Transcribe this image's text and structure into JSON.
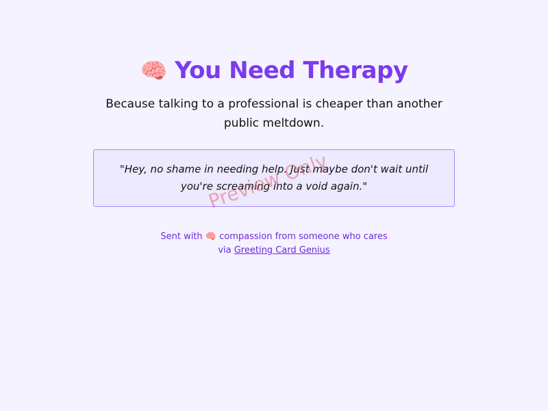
{
  "header": {
    "icon": "brain-icon",
    "emoji": "🧠",
    "title": "You Need Therapy"
  },
  "subtitle": "Because talking to a professional is cheaper than another public meltdown.",
  "quote": "\"Hey, no shame in needing help. Just maybe don't wait until you're screaming into a void again.\"",
  "footer": {
    "sent_prefix": "Sent with",
    "emoji": "🧠",
    "sent_suffix": "compassion from someone who cares",
    "via": "via",
    "link": "Greeting Card Genius"
  },
  "watermark": "Preview Only"
}
